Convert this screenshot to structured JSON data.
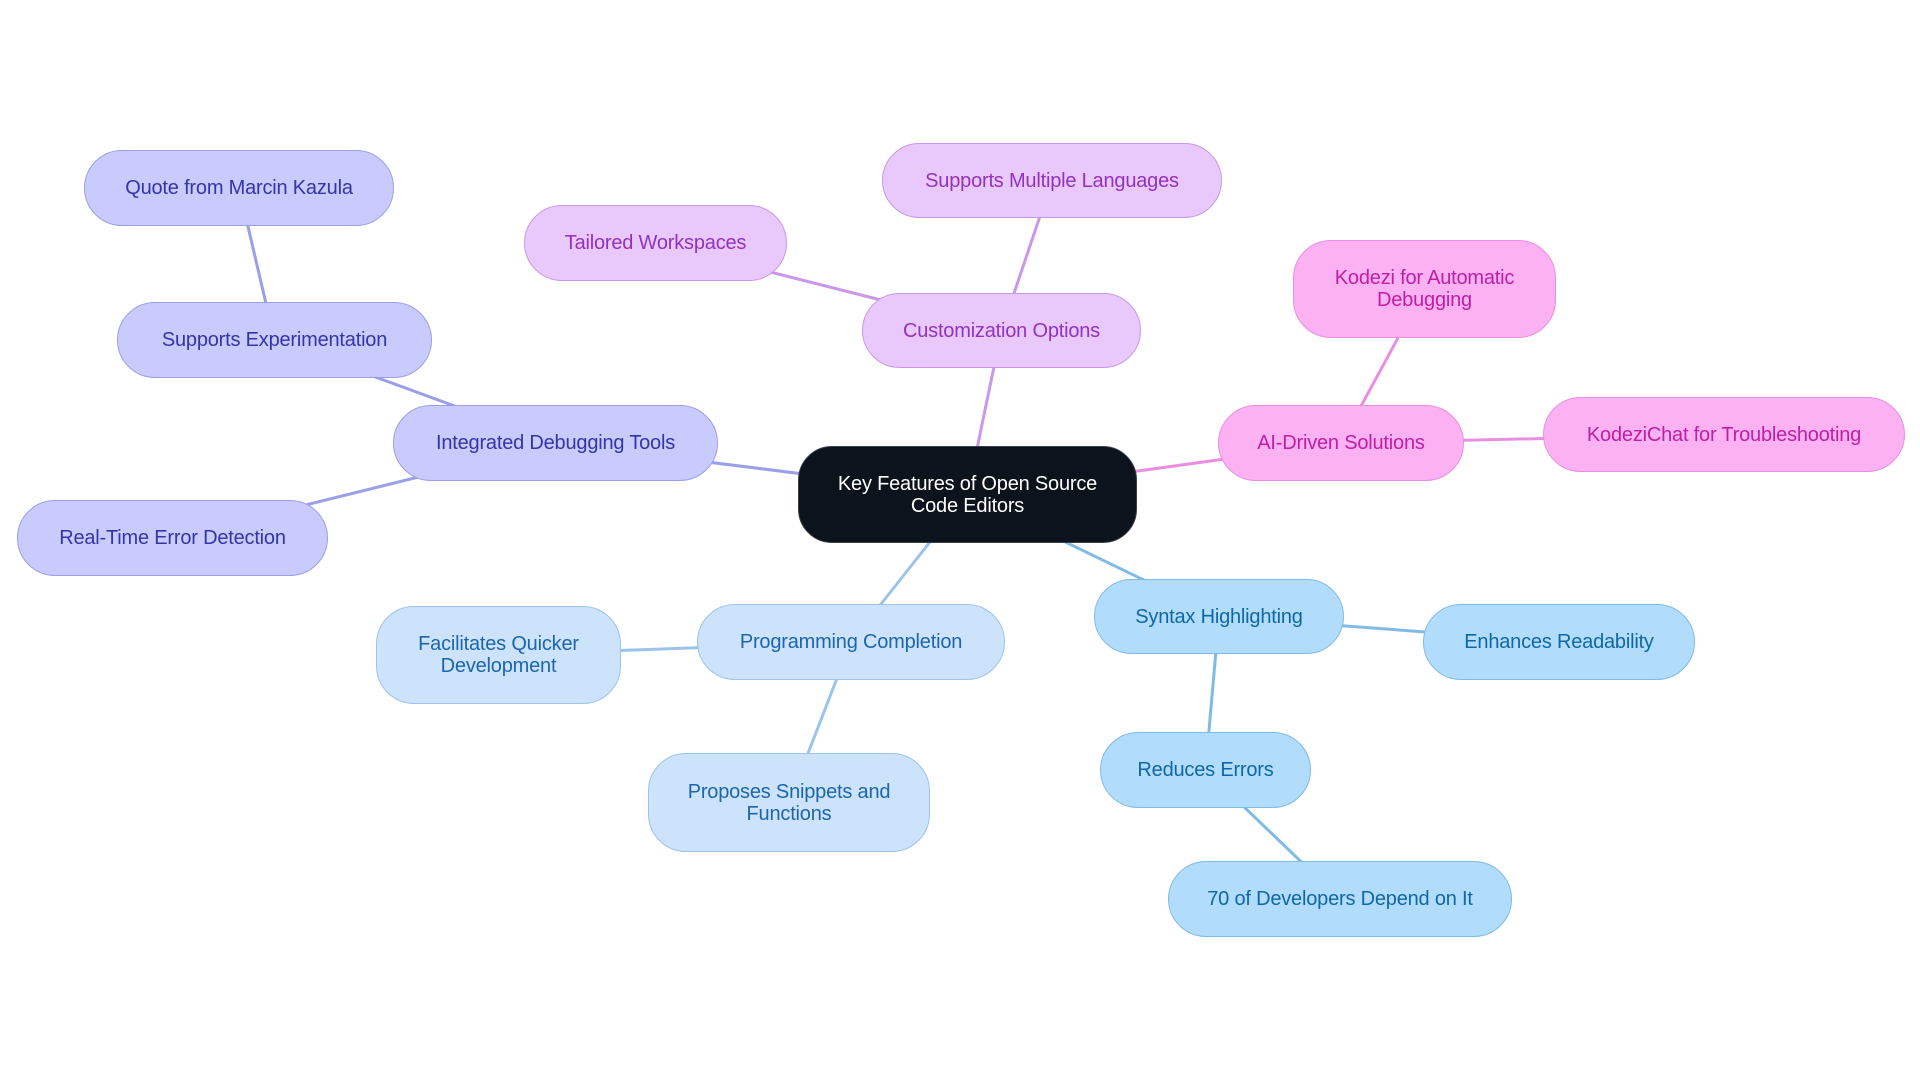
{
  "diagram": {
    "type": "mindmap",
    "root": {
      "id": "root",
      "label": "Key Features of Open Source Code Editors"
    },
    "colors": {
      "root_bg": "#0d131c",
      "indigo": "#c8cbfb",
      "purple": "#e9c9fc",
      "pink": "#fcb1f2",
      "light_blue": "#cde3fb",
      "sky": "#b2dcfb",
      "edge_indigo": "#9b9fe8",
      "edge_purple": "#c998ea",
      "edge_pink": "#ea8fdf",
      "edge_light_blue": "#9cc3ec",
      "edge_sky": "#80bbe6"
    },
    "nodes": {
      "debugging": "Integrated Debugging Tools",
      "experimentation": "Supports Experimentation",
      "quote": "Quote from Marcin Kazula",
      "realtime": "Real-Time Error Detection",
      "customization": "Customization Options",
      "workspaces": "Tailored Workspaces",
      "languages": "Supports Multiple Languages",
      "ai": "AI-Driven Solutions",
      "kodezi_debug": "Kodezi for Automatic Debugging",
      "kodezichat": "KodeziChat for Troubleshooting",
      "completion": "Programming Completion",
      "quicker": "Facilitates Quicker Development",
      "snippets": "Proposes Snippets and Functions",
      "syntax": "Syntax Highlighting",
      "readability": "Enhances Readability",
      "errors": "Reduces Errors",
      "developers": "70 of Developers Depend on It"
    },
    "edges": [
      [
        "root",
        "debugging"
      ],
      [
        "debugging",
        "experimentation"
      ],
      [
        "experimentation",
        "quote"
      ],
      [
        "debugging",
        "realtime"
      ],
      [
        "root",
        "customization"
      ],
      [
        "customization",
        "workspaces"
      ],
      [
        "customization",
        "languages"
      ],
      [
        "root",
        "ai"
      ],
      [
        "ai",
        "kodezi_debug"
      ],
      [
        "ai",
        "kodezichat"
      ],
      [
        "root",
        "completion"
      ],
      [
        "completion",
        "quicker"
      ],
      [
        "completion",
        "snippets"
      ],
      [
        "root",
        "syntax"
      ],
      [
        "syntax",
        "readability"
      ],
      [
        "syntax",
        "errors"
      ],
      [
        "errors",
        "developers"
      ]
    ]
  }
}
